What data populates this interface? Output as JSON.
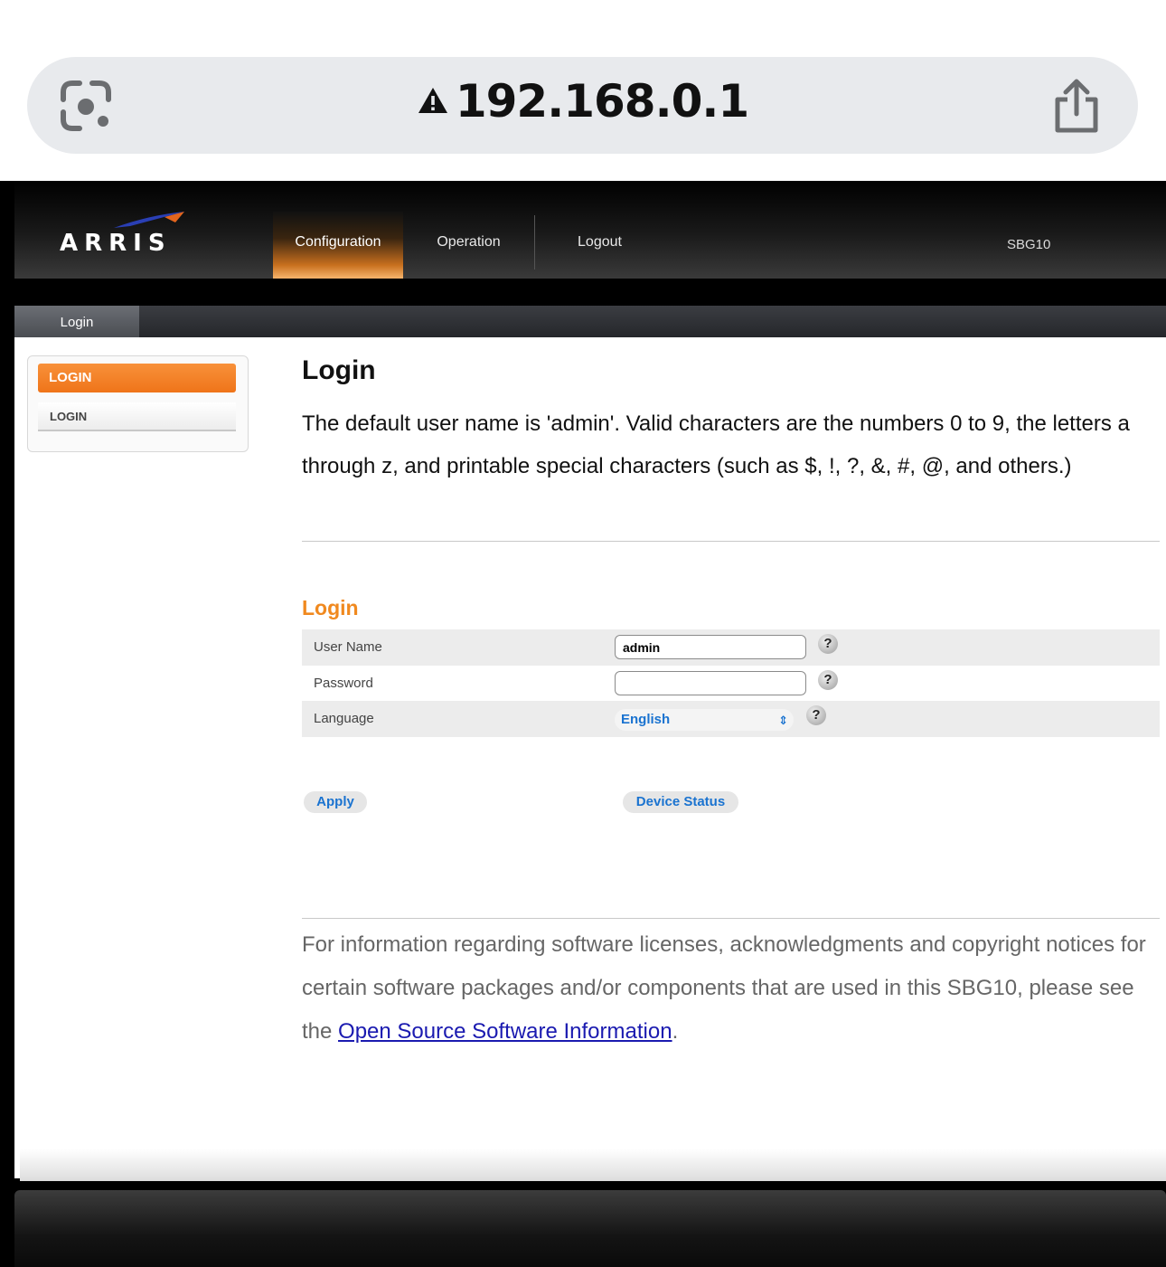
{
  "browser": {
    "url": "192.168.0.1",
    "icons": [
      "lens-icon",
      "warning-icon",
      "share-icon"
    ]
  },
  "header": {
    "logo": "ARRIS",
    "nav": [
      "Configuration",
      "Operation",
      "Logout"
    ],
    "active_nav": "Configuration",
    "model": "SBG10"
  },
  "subnav": {
    "tab": "Login"
  },
  "sidebar": {
    "active": "LOGIN",
    "items": [
      "LOGIN"
    ]
  },
  "main": {
    "title": "Login",
    "description": "The default user name is 'admin'. Valid characters are the numbers 0 to 9, the letters a through z, and printable special characters (such as $, !, ?, &, #, @, and others.)",
    "section_title": "Login",
    "form": {
      "username_label": "User Name",
      "username_value": "admin",
      "password_label": "Password",
      "password_value": "",
      "language_label": "Language",
      "language_value": "English",
      "help": "?"
    },
    "apply_label": "Apply",
    "device_status_label": "Device Status"
  },
  "footer": {
    "text_before": "For information regarding software licenses, acknowledgments and copyright notices for certain software packages and/or components that are used in this SBG10, please see the ",
    "link": "Open Source Software Information",
    "text_after": "."
  },
  "colors": {
    "accent_orange": "#f0891f",
    "link_blue": "#1a73d0"
  }
}
